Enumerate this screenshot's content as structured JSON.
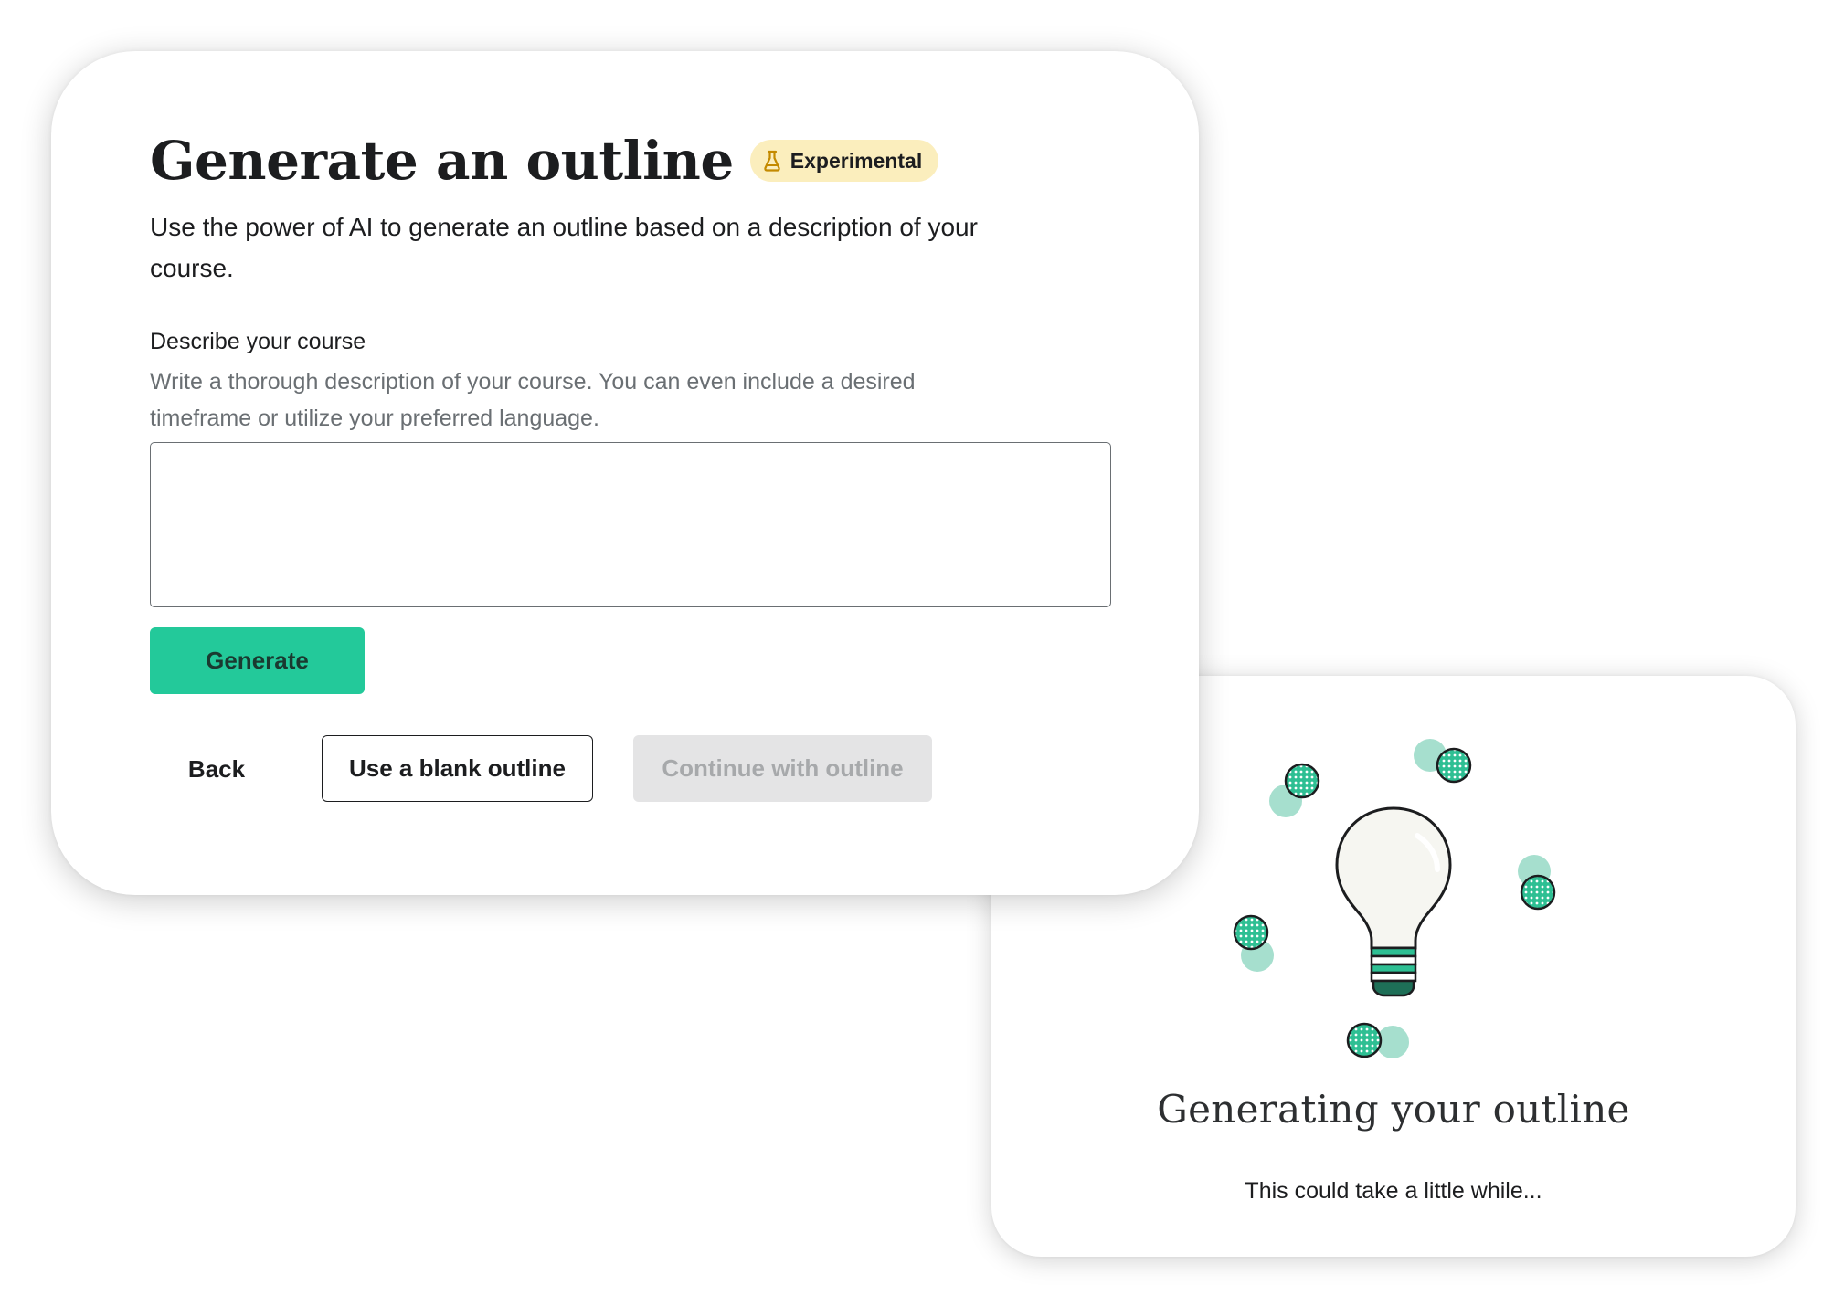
{
  "form": {
    "title": "Generate an outline",
    "badge_label": "Experimental",
    "intro": "Use the power of AI to generate an outline based on a description of your course.",
    "field_label": "Describe your course",
    "field_help": "Write a thorough description of your course. You can even include a desired timeframe or utilize your preferred language.",
    "field_value": "",
    "generate_label": "Generate",
    "back_label": "Back",
    "blank_label": "Use a blank outline",
    "continue_label": "Continue with outline"
  },
  "generating": {
    "title": "Generating your outline",
    "subtitle": "This could take a little while..."
  },
  "colors": {
    "accent": "#23c99a",
    "accent_dark": "#1e8a6a",
    "badge_bg": "#fbeebd",
    "disabled_bg": "#e4e4e5",
    "disabled_text": "#a7a9ab"
  },
  "icons": {
    "badge_icon": "flask-icon",
    "illustration": "lightbulb-icon"
  }
}
